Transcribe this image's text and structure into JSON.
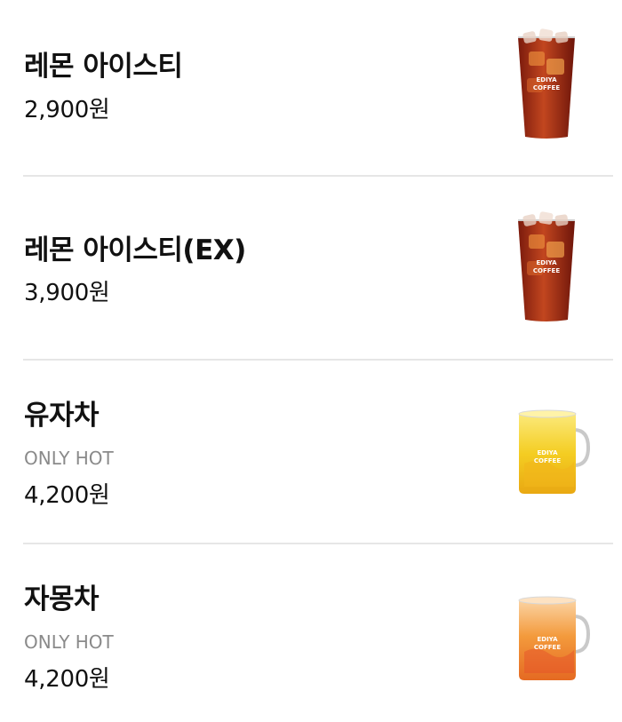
{
  "menu": {
    "items": [
      {
        "name": "레몬 아이스티",
        "price": "2,900원",
        "image": "iced-tea-cup-icon",
        "image_label": [
          "EDIYA",
          "COFFEE"
        ]
      },
      {
        "name": "레몬 아이스티(EX)",
        "price": "3,900원",
        "image": "iced-tea-cup-icon",
        "image_label": [
          "EDIYA",
          "COFFEE"
        ]
      },
      {
        "name": "유자차",
        "note": "ONLY HOT",
        "price": "4,200원",
        "image": "yuja-tea-mug-icon",
        "image_label": [
          "EDIYA",
          "COFFEE"
        ]
      },
      {
        "name": "자몽차",
        "note": "ONLY HOT",
        "price": "4,200원",
        "image": "grapefruit-tea-mug-icon",
        "image_label": [
          "EDIYA",
          "COFFEE"
        ]
      }
    ]
  },
  "colors": {
    "text": "#111111",
    "note": "#8a8a8a",
    "divider": "#e6e6e6",
    "iced_tea": "#a3321a",
    "yuja_tea": "#f2c81e",
    "grapefruit_tea": "#f08a2a"
  }
}
